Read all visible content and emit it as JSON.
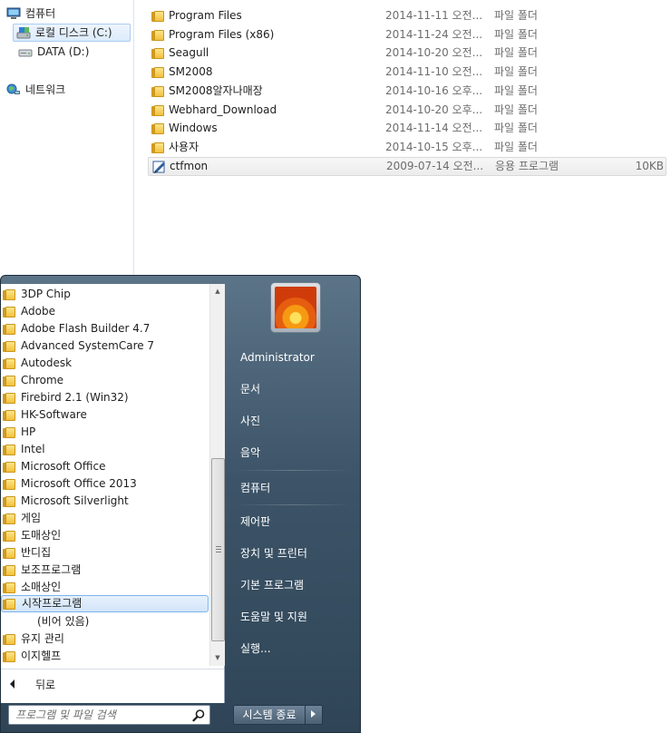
{
  "nav": {
    "items": [
      {
        "label": "컴퓨터",
        "icon": "computer-icon"
      },
      {
        "label": "로컬 디스크 (C:)",
        "icon": "local-disk-icon"
      },
      {
        "label": "DATA (D:)",
        "icon": "drive-icon"
      },
      {
        "label": "네트워크",
        "icon": "network-icon"
      }
    ]
  },
  "files": [
    {
      "name": "Program Files",
      "date": "2014-11-11 오전...",
      "type": "파일 폴더",
      "size": ""
    },
    {
      "name": "Program Files (x86)",
      "date": "2014-11-24 오전...",
      "type": "파일 폴더",
      "size": ""
    },
    {
      "name": "Seagull",
      "date": "2014-10-20 오전...",
      "type": "파일 폴더",
      "size": ""
    },
    {
      "name": "SM2008",
      "date": "2014-11-10 오전...",
      "type": "파일 폴더",
      "size": ""
    },
    {
      "name": "SM2008알자나매장",
      "date": "2014-10-16 오후...",
      "type": "파일 폴더",
      "size": ""
    },
    {
      "name": "Webhard_Download",
      "date": "2014-10-20 오후...",
      "type": "파일 폴더",
      "size": ""
    },
    {
      "name": "Windows",
      "date": "2014-11-14 오전...",
      "type": "파일 폴더",
      "size": ""
    },
    {
      "name": "사용자",
      "date": "2014-10-15 오후...",
      "type": "파일 폴더",
      "size": ""
    },
    {
      "name": "ctfmon",
      "date": "2009-07-14 오전...",
      "type": "응용 프로그램",
      "size": "10KB"
    }
  ],
  "start_menu": {
    "programs": [
      "3DP Chip",
      "Adobe",
      "Adobe Flash Builder 4.7",
      "Advanced SystemCare 7",
      "Autodesk",
      "Chrome",
      "Firebird 2.1 (Win32)",
      "HK-Software",
      "HP",
      "Intel",
      "Microsoft Office",
      "Microsoft Office 2013",
      "Microsoft Silverlight",
      "게임",
      "도매상인",
      "반디집",
      "보조프로그램",
      "소매상인",
      "시작프로그램",
      "(비어 있음)",
      "유지 관리",
      "이지헬프"
    ],
    "back_label": "뒤로",
    "search_placeholder": "프로그램 및 파일 검색",
    "user_name": "Administrator",
    "right_items": [
      "문서",
      "사진",
      "음악",
      "컴퓨터",
      "제어판",
      "장치 및 프린터",
      "기본 프로그램",
      "도움말 및 지원",
      "실행..."
    ],
    "shutdown_label": "시스템 종료"
  },
  "colors": {
    "menu_top": "#5c7488",
    "menu_bottom": "#2f4557",
    "highlight_border": "#7eb4ea",
    "folder": "#f2c13d"
  }
}
